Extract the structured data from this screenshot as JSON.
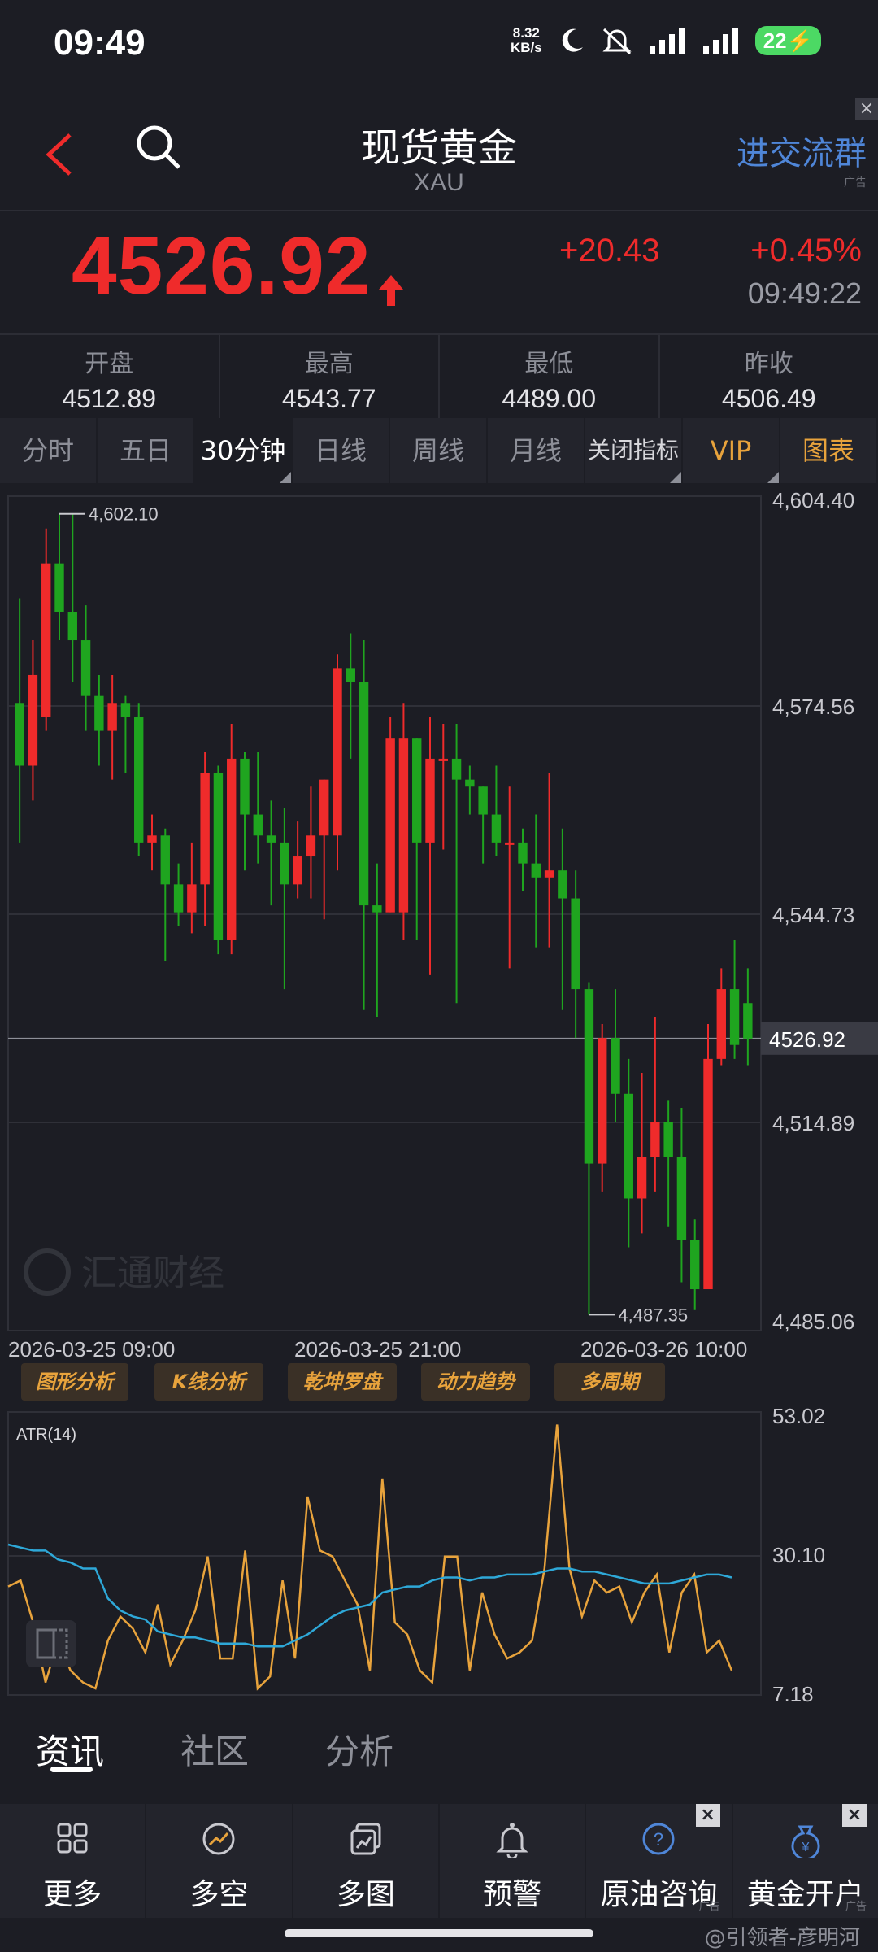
{
  "status_bar": {
    "time": "09:49",
    "net_speed_value": "8.32",
    "net_speed_unit": "KB/s",
    "battery": "22"
  },
  "header": {
    "title": "现货黄金",
    "subtitle": "XAU",
    "ad_text": "进交流群",
    "ad_tag": "广告",
    "ad_close": "×"
  },
  "quote": {
    "price": "4526.92",
    "change_abs": "+20.43",
    "change_pct": "+0.45%",
    "time": "09:49:22",
    "color_up": "#ef2b2b"
  },
  "stats": [
    {
      "label": "开盘",
      "value": "4512.89"
    },
    {
      "label": "最高",
      "value": "4543.77"
    },
    {
      "label": "最低",
      "value": "4489.00"
    },
    {
      "label": "昨收",
      "value": "4506.49"
    }
  ],
  "tabs": [
    {
      "label": "分时"
    },
    {
      "label": "五日"
    },
    {
      "label": "30分钟"
    },
    {
      "label": "日线"
    },
    {
      "label": "周线"
    },
    {
      "label": "月线"
    },
    {
      "label": "关闭指标"
    },
    {
      "label": "VIP"
    },
    {
      "label": "图表"
    }
  ],
  "chart_watermark": "汇通财经",
  "chart_data": [
    {
      "type": "candlestick",
      "y_ticks": [
        "4,604.40",
        "4,574.56",
        "4,544.73",
        "4,514.89",
        "4,485.06"
      ],
      "ylim": [
        4485.06,
        4604.4
      ],
      "current_price_label": "4526.92",
      "current_price": 4526.92,
      "max_annotation": "4,602.10",
      "min_annotation": "4,487.35",
      "x_labels": [
        "2026-03-25 09:00",
        "2026-03-25 21:00",
        "2026-03-26 10:00"
      ],
      "candles": [
        [
          4575,
          4566,
          4590,
          4555
        ],
        [
          4566,
          4579,
          4584,
          4561
        ],
        [
          4573,
          4595,
          4600,
          4571
        ],
        [
          4595,
          4588,
          4602.1,
          4584
        ],
        [
          4588,
          4584,
          4602.1,
          4578
        ],
        [
          4584,
          4576,
          4589,
          4571
        ],
        [
          4576,
          4571,
          4579,
          4566
        ],
        [
          4571,
          4575,
          4579,
          4564
        ],
        [
          4575,
          4573,
          4576,
          4565
        ],
        [
          4573,
          4555,
          4575,
          4553
        ],
        [
          4555,
          4556,
          4559,
          4551
        ],
        [
          4556,
          4549,
          4557,
          4538
        ],
        [
          4549,
          4545,
          4552,
          4543
        ],
        [
          4545,
          4549,
          4555,
          4542
        ],
        [
          4549,
          4565,
          4568,
          4543
        ],
        [
          4565,
          4541,
          4566,
          4539
        ],
        [
          4541,
          4567,
          4572,
          4539
        ],
        [
          4567,
          4559,
          4568,
          4551
        ],
        [
          4559,
          4556,
          4568,
          4552
        ],
        [
          4556,
          4555,
          4561,
          4546
        ],
        [
          4555,
          4549,
          4560,
          4534
        ],
        [
          4549,
          4553,
          4558,
          4547
        ],
        [
          4553,
          4556,
          4563,
          4547
        ],
        [
          4556,
          4564,
          4564,
          4544
        ],
        [
          4556,
          4580,
          4582,
          4551
        ],
        [
          4580,
          4578,
          4585,
          4567
        ],
        [
          4578,
          4546,
          4584,
          4531
        ],
        [
          4546,
          4545,
          4552,
          4530
        ],
        [
          4545,
          4570,
          4573,
          4545
        ],
        [
          4545,
          4570,
          4575,
          4541
        ],
        [
          4570,
          4555,
          4570,
          4541
        ],
        [
          4555,
          4567,
          4573,
          4536
        ],
        [
          4567,
          4567,
          4572,
          4554
        ],
        [
          4567,
          4564,
          4572,
          4532
        ],
        [
          4564,
          4563,
          4566,
          4559
        ],
        [
          4563,
          4559,
          4563,
          4552
        ],
        [
          4559,
          4555,
          4566,
          4553
        ],
        [
          4555,
          4555,
          4563,
          4537
        ],
        [
          4555,
          4552,
          4557,
          4548
        ],
        [
          4552,
          4550,
          4559,
          4540
        ],
        [
          4550,
          4551,
          4565,
          4540
        ],
        [
          4551,
          4547,
          4557,
          4531
        ],
        [
          4547,
          4534,
          4551,
          4527
        ],
        [
          4534,
          4509,
          4535,
          4487.35
        ],
        [
          4509,
          4527,
          4529,
          4505
        ],
        [
          4527,
          4519,
          4534,
          4515
        ],
        [
          4519,
          4504,
          4524,
          4497
        ],
        [
          4504,
          4510,
          4522,
          4499
        ],
        [
          4510,
          4515,
          4530,
          4505
        ],
        [
          4515,
          4510,
          4518,
          4500
        ],
        [
          4510,
          4498,
          4517,
          4492
        ],
        [
          4498,
          4491,
          4501,
          4488
        ],
        [
          4491,
          4524,
          4529,
          4492
        ],
        [
          4524,
          4534,
          4537,
          4523
        ],
        [
          4534,
          4526,
          4541,
          4524
        ],
        [
          4532,
          4526.92,
          4537,
          4523
        ]
      ]
    },
    {
      "type": "line",
      "title": "ATR(14)",
      "y_ticks": [
        "53.02",
        "30.10",
        "7.18"
      ],
      "ylim": [
        7.18,
        53.02
      ],
      "series": [
        {
          "color": "#e8a33c",
          "values": [
            25,
            26,
            19,
            9,
            16,
            11,
            9,
            8,
            16,
            20,
            18,
            14,
            22,
            12,
            16,
            21,
            30,
            13,
            13,
            31,
            8,
            10,
            26,
            13,
            40,
            31,
            30,
            26,
            22,
            11,
            43,
            19,
            17,
            11,
            9,
            30,
            30,
            11,
            24,
            17,
            13,
            14,
            16,
            28,
            52,
            28,
            20,
            26,
            24,
            25,
            19,
            24,
            27,
            14,
            24,
            27,
            14,
            16,
            11
          ]
        },
        {
          "color": "#2ea8d8",
          "values": [
            32,
            31.5,
            31,
            31,
            29.5,
            29,
            28,
            28,
            23,
            21,
            20,
            19.5,
            17.5,
            17,
            16.5,
            16.5,
            16,
            15.5,
            15.5,
            15.5,
            15,
            15,
            15,
            16,
            17,
            18.5,
            20,
            21,
            21.5,
            22,
            24,
            24.5,
            25,
            25,
            26,
            26.5,
            26.5,
            26,
            26.5,
            26.5,
            27,
            27,
            27,
            27.5,
            28,
            28,
            27.5,
            27.5,
            27,
            26.5,
            26,
            25.5,
            25.5,
            25.5,
            26,
            26.5,
            27,
            27,
            26.5
          ]
        }
      ]
    }
  ],
  "tools": [
    "图形分析",
    "K线分析",
    "乾坤罗盘",
    "动力趋势",
    "多周期"
  ],
  "news_tabs": [
    "资讯",
    "社区",
    "分析"
  ],
  "bottom_nav": [
    {
      "label": "更多",
      "icon": "grid-icon"
    },
    {
      "label": "多空",
      "icon": "trend-icon"
    },
    {
      "label": "多图",
      "icon": "multi-chart-icon"
    },
    {
      "label": "预警",
      "icon": "bell-icon"
    },
    {
      "label": "原油咨询",
      "icon": "consult-icon",
      "ad": "广告",
      "close": "×"
    },
    {
      "label": "黄金开户",
      "icon": "moneybag-icon",
      "ad": "广告",
      "close": "×"
    }
  ],
  "watermark": "@引领者-彦明河"
}
